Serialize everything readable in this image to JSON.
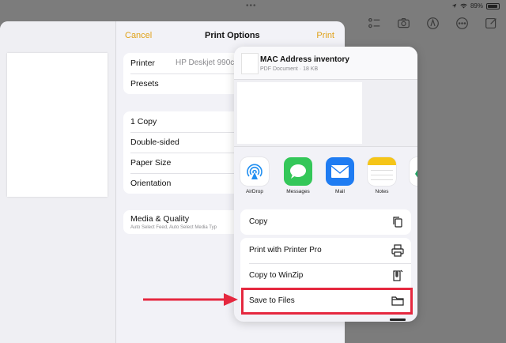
{
  "status": {
    "dots": "•••",
    "battery": "89%"
  },
  "notes_toolbar": {
    "icons": [
      "checklist-icon",
      "camera-icon",
      "markup-icon",
      "more-icon",
      "compose-icon"
    ]
  },
  "print_options": {
    "cancel": "Cancel",
    "title": "Print Options",
    "print": "Print",
    "printer_label": "Printer",
    "printer_value": "HP Deskjet 990c",
    "presets_label": "Presets",
    "copies": "1 Copy",
    "double_sided": "Double-sided",
    "paper_size": "Paper Size",
    "orientation": "Orientation",
    "media_quality": "Media & Quality",
    "media_quality_sub": "Auto Select Feed, Auto Select Media Typ"
  },
  "share_sheet": {
    "doc_title": "MAC Address inventory",
    "doc_subtitle": "PDF Document · 18 KB",
    "apps": [
      {
        "label": "AirDrop",
        "color": "#ffffff"
      },
      {
        "label": "Messages",
        "color": "#34c759"
      },
      {
        "label": "Mail",
        "color": "#1f7cf2"
      },
      {
        "label": "Notes",
        "color": "#ffffff"
      }
    ],
    "actions_group1": [
      "Copy"
    ],
    "actions_group2": [
      "Print with Printer Pro",
      "Copy to WinZip",
      "Save to Files"
    ]
  },
  "colors": {
    "accent": "#e0a21a",
    "highlight": "#e5283f"
  }
}
